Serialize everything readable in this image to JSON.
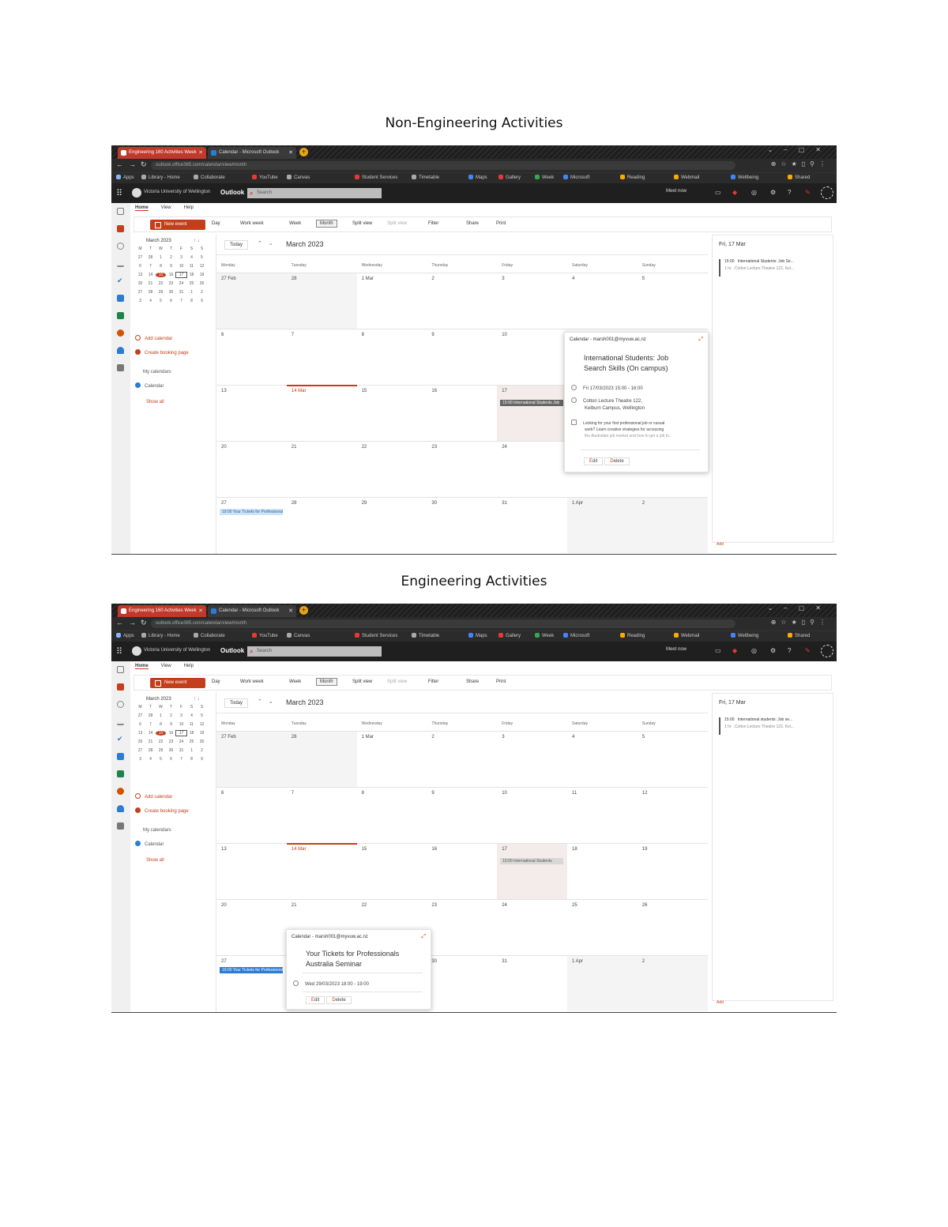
{
  "headings": {
    "first": "Non-Engineering Activities",
    "second": "Engineering Activities"
  },
  "browser": {
    "tabs": [
      "Engineering 160 Activities Week",
      "Calendar - Microsoft Outlook"
    ],
    "url": "outlook.office365.com/calendar/view/month",
    "bookmarks": [
      "Apps",
      "Library - Home",
      "Collaborate",
      "YouTube",
      "Canvas",
      "Student Services",
      "Timetable",
      "Maps",
      "Gallery",
      "Week",
      "Microsoft",
      "Reading",
      "Webmail",
      "Wellbeing",
      "Shared"
    ]
  },
  "outlook": {
    "org_name": "Victoria University of Wellington",
    "brand": "Outlook",
    "search_placeholder": "Search",
    "meet_now": "Meet now",
    "ribbon_tabs": [
      "Home",
      "View",
      "Help"
    ],
    "new_event": "New event",
    "ribbon_items": [
      "Day",
      "Work week",
      "Week",
      "Month",
      "Split view",
      "Filter",
      "Share",
      "Print"
    ],
    "mini_calendar": {
      "title": "March 2023",
      "dow": [
        "M",
        "T",
        "W",
        "T",
        "F",
        "S",
        "S"
      ],
      "days": [
        "27",
        "28",
        "1",
        "2",
        "3",
        "4",
        "5",
        "6",
        "7",
        "8",
        "9",
        "10",
        "11",
        "12",
        "13",
        "14",
        "15",
        "16",
        "17",
        "18",
        "19",
        "20",
        "21",
        "22",
        "23",
        "24",
        "25",
        "26",
        "27",
        "28",
        "29",
        "30",
        "31",
        "1",
        "2",
        "3",
        "4",
        "5",
        "6",
        "7",
        "8",
        "9"
      ]
    },
    "side": {
      "add_calendar": "Add calendar",
      "create_booking": "Create booking page",
      "my_calendars": "My calendars",
      "calendar": "Calendar",
      "show_all": "Show all"
    },
    "toolbar": {
      "today": "Today",
      "month_title": "March 2023"
    },
    "dow_full": [
      "Monday",
      "Tuesday",
      "Wednesday",
      "Thursday",
      "Friday",
      "Saturday",
      "Sunday"
    ],
    "weeks": [
      [
        "27 Feb",
        "28",
        "1 Mar",
        "2",
        "3",
        "4",
        "5"
      ],
      [
        "6",
        "7",
        "8",
        "9",
        "10",
        "11",
        "12"
      ],
      [
        "13",
        "14 Mar",
        "15",
        "16",
        "17",
        "18",
        "19"
      ],
      [
        "20",
        "21",
        "22",
        "23",
        "24",
        "25",
        "26"
      ],
      [
        "27",
        "28",
        "29",
        "30",
        "31",
        "1 Apr",
        "2"
      ]
    ],
    "events": {
      "intl_short": "15:00 International Students Job",
      "intl_short_2": "15:00 International Students",
      "tickets_short": "19:00 Your Tickets for Professionals"
    },
    "agenda": {
      "date": "Fri, 17 Mar",
      "time": "15:00",
      "duration": "1 hr",
      "title": "International Students: Job Se...",
      "title_2": "International students: Job se...",
      "location": "Cotton Lecture Theatre 122, Kel...",
      "footer": "Add"
    }
  },
  "popup_one": {
    "calendar": "Calendar - marsh001@myvuw.ac.nz",
    "title_line1": "International Students: Job",
    "title_line2": "Search Skills (On campus)",
    "when": "Fri 17/03/2023 15:00 - 16:00",
    "where_line1": "Cotton Lecture Theatre 122,",
    "where_line2": "Kelburn Campus, Wellington",
    "desc_line1": "Looking for your first professional job or casual",
    "desc_line2": "work? Learn creative strategies for accessing",
    "desc_line3": "the Australian job market and how to get a job in...",
    "edit": "Edit",
    "delete": "Delete"
  },
  "popup_two": {
    "calendar": "Calendar - marsh001@myvuw.ac.nz",
    "title_line1": "Your Tickets for Professionals",
    "title_line2": "Australia Seminar",
    "when": "Wed 29/03/2023 18:00 - 19:00",
    "edit": "Edit",
    "delete": "Delete"
  },
  "colors": {
    "accent": "#c43e1c",
    "header_bg": "#1f1f1f",
    "event_blue": "#2b7cd3"
  }
}
